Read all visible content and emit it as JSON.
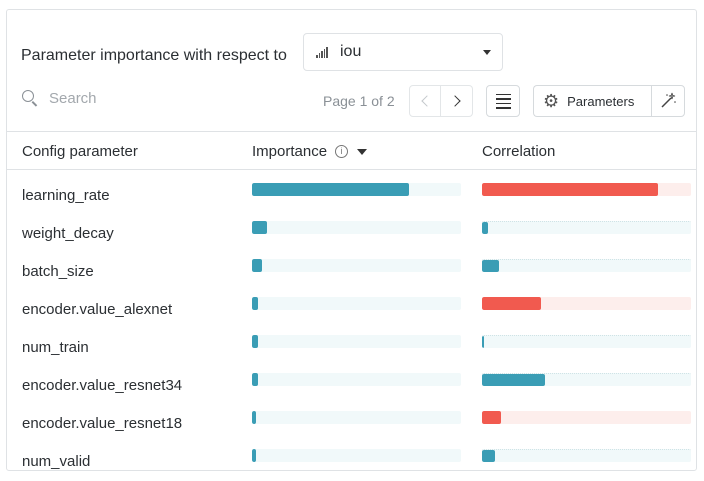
{
  "header": {
    "title": "Parameter importance with respect to",
    "metric": "iou"
  },
  "toolbar": {
    "search_placeholder": "Search",
    "pager_text": "Page 1 of 2",
    "parameters_label": "Parameters"
  },
  "table": {
    "columns": {
      "param": "Config parameter",
      "importance": "Importance",
      "correlation": "Correlation"
    },
    "rows": [
      {
        "name": "learning_rate",
        "importance": 0.75,
        "correlation": 0.84,
        "correlation_sign": "negative"
      },
      {
        "name": "weight_decay",
        "importance": 0.07,
        "correlation": 0.03,
        "correlation_sign": "positive"
      },
      {
        "name": "batch_size",
        "importance": 0.05,
        "correlation": 0.08,
        "correlation_sign": "positive"
      },
      {
        "name": "encoder.value_alexnet",
        "importance": 0.03,
        "correlation": 0.28,
        "correlation_sign": "negative"
      },
      {
        "name": "num_train",
        "importance": 0.03,
        "correlation": 0.01,
        "correlation_sign": "positive"
      },
      {
        "name": "encoder.value_resnet34",
        "importance": 0.03,
        "correlation": 0.3,
        "correlation_sign": "positive"
      },
      {
        "name": "encoder.value_resnet18",
        "importance": 0.02,
        "correlation": 0.09,
        "correlation_sign": "negative"
      },
      {
        "name": "num_valid",
        "importance": 0.02,
        "correlation": 0.06,
        "correlation_sign": "positive"
      }
    ]
  },
  "colors": {
    "importance": "#3a9db5",
    "correlation_positive": "#3a9db5",
    "correlation_negative": "#f15a4f"
  }
}
